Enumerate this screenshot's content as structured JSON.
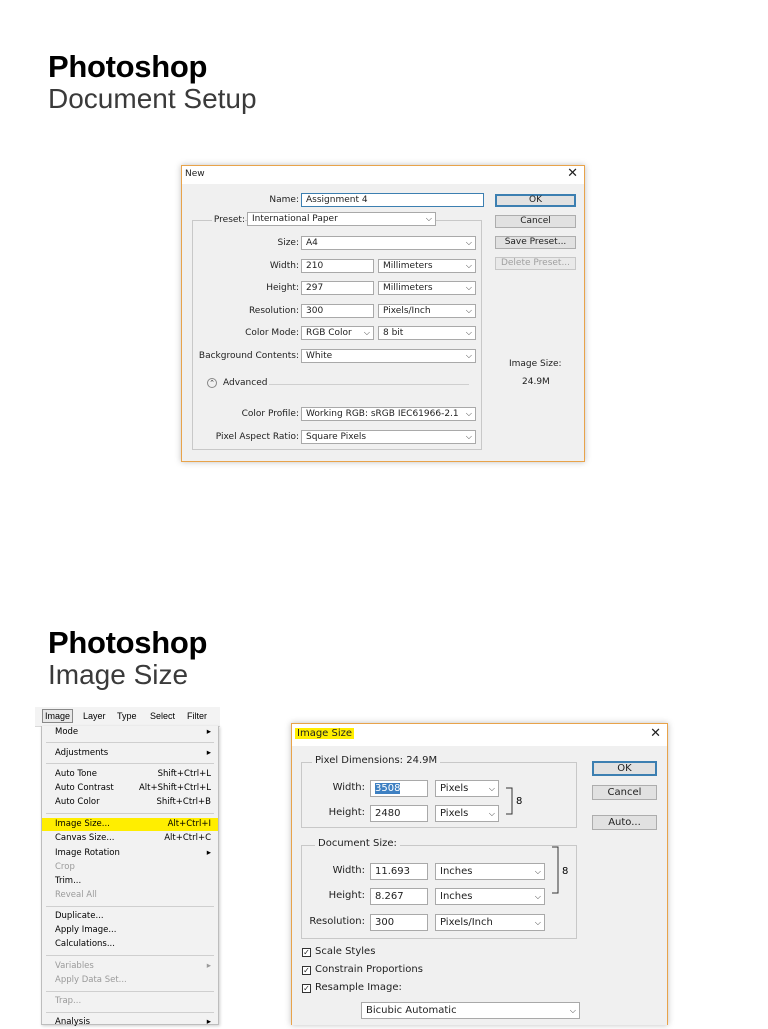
{
  "section1": {
    "title": "Photoshop",
    "subtitle": "Document Setup"
  },
  "section2": {
    "title": "Photoshop",
    "subtitle": "Image Size"
  },
  "new_dialog": {
    "title": "New",
    "close": "✕",
    "name_label": "Name:",
    "name_value": "Assignment 4",
    "preset_label": "Preset:",
    "preset_value": "International Paper",
    "size_label": "Size:",
    "size_value": "A4",
    "width_label": "Width:",
    "width_value": "210",
    "width_unit": "Millimeters",
    "height_label": "Height:",
    "height_value": "297",
    "height_unit": "Millimeters",
    "resolution_label": "Resolution:",
    "resolution_value": "300",
    "resolution_unit": "Pixels/Inch",
    "color_mode_label": "Color Mode:",
    "color_mode_value": "RGB Color",
    "bit_depth_value": "8 bit",
    "background_label": "Background Contents:",
    "background_value": "White",
    "advanced_label": "Advanced",
    "color_profile_label": "Color Profile:",
    "color_profile_value": "Working RGB:  sRGB IEC61966-2.1",
    "pixel_aspect_label": "Pixel Aspect Ratio:",
    "pixel_aspect_value": "Square Pixels",
    "ok_label": "OK",
    "cancel_label": "Cancel",
    "save_preset_label": "Save Preset...",
    "delete_preset_label": "Delete Preset...",
    "image_size_label": "Image Size:",
    "image_size_value": "24.9M"
  },
  "menu": {
    "bar": [
      "Image",
      "Layer",
      "Type",
      "Select",
      "Filter"
    ],
    "items": [
      {
        "label": "Mode",
        "shortcut": "",
        "submenu": true,
        "disabled": false
      },
      {
        "label": "Adjustments",
        "shortcut": "",
        "submenu": true,
        "disabled": false
      },
      {
        "label": "Auto Tone",
        "shortcut": "Shift+Ctrl+L",
        "disabled": false
      },
      {
        "label": "Auto Contrast",
        "shortcut": "Alt+Shift+Ctrl+L",
        "disabled": false
      },
      {
        "label": "Auto Color",
        "shortcut": "Shift+Ctrl+B",
        "disabled": false
      },
      {
        "label": "Image Size...",
        "shortcut": "Alt+Ctrl+I",
        "disabled": false,
        "highlight": true
      },
      {
        "label": "Canvas Size...",
        "shortcut": "Alt+Ctrl+C",
        "disabled": false
      },
      {
        "label": "Image Rotation",
        "shortcut": "",
        "submenu": true,
        "disabled": false
      },
      {
        "label": "Crop",
        "shortcut": "",
        "disabled": true
      },
      {
        "label": "Trim...",
        "shortcut": "",
        "disabled": false
      },
      {
        "label": "Reveal All",
        "shortcut": "",
        "disabled": true
      },
      {
        "label": "Duplicate...",
        "shortcut": "",
        "disabled": false
      },
      {
        "label": "Apply Image...",
        "shortcut": "",
        "disabled": false
      },
      {
        "label": "Calculations...",
        "shortcut": "",
        "disabled": false
      },
      {
        "label": "Variables",
        "shortcut": "",
        "submenu": true,
        "disabled": true
      },
      {
        "label": "Apply Data Set...",
        "shortcut": "",
        "disabled": true
      },
      {
        "label": "Trap...",
        "shortcut": "",
        "disabled": true
      },
      {
        "label": "Analysis",
        "shortcut": "",
        "submenu": true,
        "disabled": false
      }
    ]
  },
  "imgsize_dialog": {
    "title": "Image Size",
    "close": "✕",
    "pixel_dimensions_label": "Pixel Dimensions:  24.9M",
    "px_width_label": "Width:",
    "px_width_value": "3508",
    "px_width_unit": "Pixels",
    "px_height_label": "Height:",
    "px_height_value": "2480",
    "px_height_unit": "Pixels",
    "document_size_label": "Document Size:",
    "doc_width_label": "Width:",
    "doc_width_value": "11.693",
    "doc_width_unit": "Inches",
    "doc_height_label": "Height:",
    "doc_height_value": "8.267",
    "doc_height_unit": "Inches",
    "resolution_label": "Resolution:",
    "resolution_value": "300",
    "resolution_unit": "Pixels/Inch",
    "scale_styles_label": "Scale Styles",
    "constrain_label": "Constrain Proportions",
    "resample_label": "Resample Image:",
    "resample_value": "Bicubic Automatic",
    "ok_label": "OK",
    "cancel_label": "Cancel",
    "auto_label": "Auto...",
    "scale_styles_checked": true,
    "constrain_checked": true,
    "resample_checked": true
  },
  "icons": {
    "chevron": "chevron-down-icon",
    "submenu_arrow": "chevron-right-icon",
    "link": "chain-link-icon",
    "advanced": "collapse-icon"
  }
}
